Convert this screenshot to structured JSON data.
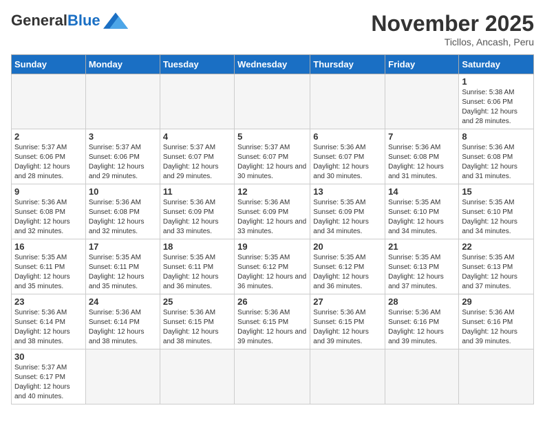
{
  "header": {
    "logo_general": "General",
    "logo_blue": "Blue",
    "month_title": "November 2025",
    "location": "Ticllos, Ancash, Peru"
  },
  "days_of_week": [
    "Sunday",
    "Monday",
    "Tuesday",
    "Wednesday",
    "Thursday",
    "Friday",
    "Saturday"
  ],
  "weeks": [
    [
      {
        "day": "",
        "info": ""
      },
      {
        "day": "",
        "info": ""
      },
      {
        "day": "",
        "info": ""
      },
      {
        "day": "",
        "info": ""
      },
      {
        "day": "",
        "info": ""
      },
      {
        "day": "",
        "info": ""
      },
      {
        "day": "1",
        "info": "Sunrise: 5:38 AM\nSunset: 6:06 PM\nDaylight: 12 hours and 28 minutes."
      }
    ],
    [
      {
        "day": "2",
        "info": "Sunrise: 5:37 AM\nSunset: 6:06 PM\nDaylight: 12 hours and 28 minutes."
      },
      {
        "day": "3",
        "info": "Sunrise: 5:37 AM\nSunset: 6:06 PM\nDaylight: 12 hours and 29 minutes."
      },
      {
        "day": "4",
        "info": "Sunrise: 5:37 AM\nSunset: 6:07 PM\nDaylight: 12 hours and 29 minutes."
      },
      {
        "day": "5",
        "info": "Sunrise: 5:37 AM\nSunset: 6:07 PM\nDaylight: 12 hours and 30 minutes."
      },
      {
        "day": "6",
        "info": "Sunrise: 5:36 AM\nSunset: 6:07 PM\nDaylight: 12 hours and 30 minutes."
      },
      {
        "day": "7",
        "info": "Sunrise: 5:36 AM\nSunset: 6:08 PM\nDaylight: 12 hours and 31 minutes."
      },
      {
        "day": "8",
        "info": "Sunrise: 5:36 AM\nSunset: 6:08 PM\nDaylight: 12 hours and 31 minutes."
      }
    ],
    [
      {
        "day": "9",
        "info": "Sunrise: 5:36 AM\nSunset: 6:08 PM\nDaylight: 12 hours and 32 minutes."
      },
      {
        "day": "10",
        "info": "Sunrise: 5:36 AM\nSunset: 6:08 PM\nDaylight: 12 hours and 32 minutes."
      },
      {
        "day": "11",
        "info": "Sunrise: 5:36 AM\nSunset: 6:09 PM\nDaylight: 12 hours and 33 minutes."
      },
      {
        "day": "12",
        "info": "Sunrise: 5:36 AM\nSunset: 6:09 PM\nDaylight: 12 hours and 33 minutes."
      },
      {
        "day": "13",
        "info": "Sunrise: 5:35 AM\nSunset: 6:09 PM\nDaylight: 12 hours and 34 minutes."
      },
      {
        "day": "14",
        "info": "Sunrise: 5:35 AM\nSunset: 6:10 PM\nDaylight: 12 hours and 34 minutes."
      },
      {
        "day": "15",
        "info": "Sunrise: 5:35 AM\nSunset: 6:10 PM\nDaylight: 12 hours and 34 minutes."
      }
    ],
    [
      {
        "day": "16",
        "info": "Sunrise: 5:35 AM\nSunset: 6:11 PM\nDaylight: 12 hours and 35 minutes."
      },
      {
        "day": "17",
        "info": "Sunrise: 5:35 AM\nSunset: 6:11 PM\nDaylight: 12 hours and 35 minutes."
      },
      {
        "day": "18",
        "info": "Sunrise: 5:35 AM\nSunset: 6:11 PM\nDaylight: 12 hours and 36 minutes."
      },
      {
        "day": "19",
        "info": "Sunrise: 5:35 AM\nSunset: 6:12 PM\nDaylight: 12 hours and 36 minutes."
      },
      {
        "day": "20",
        "info": "Sunrise: 5:35 AM\nSunset: 6:12 PM\nDaylight: 12 hours and 36 minutes."
      },
      {
        "day": "21",
        "info": "Sunrise: 5:35 AM\nSunset: 6:13 PM\nDaylight: 12 hours and 37 minutes."
      },
      {
        "day": "22",
        "info": "Sunrise: 5:35 AM\nSunset: 6:13 PM\nDaylight: 12 hours and 37 minutes."
      }
    ],
    [
      {
        "day": "23",
        "info": "Sunrise: 5:36 AM\nSunset: 6:14 PM\nDaylight: 12 hours and 38 minutes."
      },
      {
        "day": "24",
        "info": "Sunrise: 5:36 AM\nSunset: 6:14 PM\nDaylight: 12 hours and 38 minutes."
      },
      {
        "day": "25",
        "info": "Sunrise: 5:36 AM\nSunset: 6:15 PM\nDaylight: 12 hours and 38 minutes."
      },
      {
        "day": "26",
        "info": "Sunrise: 5:36 AM\nSunset: 6:15 PM\nDaylight: 12 hours and 39 minutes."
      },
      {
        "day": "27",
        "info": "Sunrise: 5:36 AM\nSunset: 6:15 PM\nDaylight: 12 hours and 39 minutes."
      },
      {
        "day": "28",
        "info": "Sunrise: 5:36 AM\nSunset: 6:16 PM\nDaylight: 12 hours and 39 minutes."
      },
      {
        "day": "29",
        "info": "Sunrise: 5:36 AM\nSunset: 6:16 PM\nDaylight: 12 hours and 39 minutes."
      }
    ],
    [
      {
        "day": "30",
        "info": "Sunrise: 5:37 AM\nSunset: 6:17 PM\nDaylight: 12 hours and 40 minutes."
      },
      {
        "day": "",
        "info": ""
      },
      {
        "day": "",
        "info": ""
      },
      {
        "day": "",
        "info": ""
      },
      {
        "day": "",
        "info": ""
      },
      {
        "day": "",
        "info": ""
      },
      {
        "day": "",
        "info": ""
      }
    ]
  ]
}
